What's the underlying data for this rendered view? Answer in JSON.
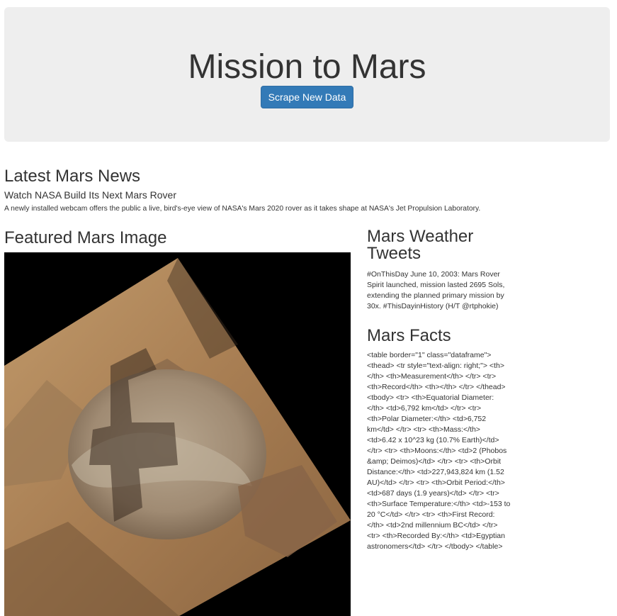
{
  "header": {
    "title": "Mission to Mars",
    "scrape_button_label": "Scrape New Data"
  },
  "news": {
    "section_title": "Latest Mars News",
    "headline": "Watch NASA Build Its Next Mars Rover",
    "teaser": "A newly installed webcam offers the public a live, bird's-eye view of NASA's Mars 2020 rover as it takes shape at NASA's Jet Propulsion Laboratory."
  },
  "featured": {
    "section_title": "Featured Mars Image"
  },
  "weather": {
    "section_title": "Mars Weather Tweets",
    "tweet": "#OnThisDay June 10, 2003: Mars Rover Spirit launched, mission lasted 2695 Sols, extending the planned primary mission by 30x. #ThisDayinHistory (H/T @rtphokie)"
  },
  "facts": {
    "section_title": "Mars Facts",
    "raw_table_html": "<table border=\"1\" class=\"dataframe\"> <thead> <tr style=\"text-align: right;\"> <th></th> <th>Measurement</th> </tr> <tr> <th>Record</th> <th></th> </tr> </thead> <tbody> <tr> <th>Equatorial Diameter:</th> <td>6,792 km</td> </tr> <tr> <th>Polar Diameter:</th> <td>6,752 km</td> </tr> <tr> <th>Mass:</th> <td>6.42 x 10^23 kg (10.7% Earth)</td> </tr> <tr> <th>Moons:</th> <td>2 (Phobos &amp; Deimos)</td> </tr> <tr> <th>Orbit Distance:</th> <td>227,943,824 km (1.52 AU)</td> </tr> <tr> <th>Orbit Period:</th> <td>687 days (1.9 years)</td> </tr> <tr> <th>Surface Temperature:</th> <td>-153 to 20 °C</td> </tr> <tr> <th>First Record:</th> <td>2nd millennium BC</td> </tr> <tr> <th>Recorded By:</th> <td>Egyptian astronomers</td> </tr> </tbody> </table>"
  }
}
